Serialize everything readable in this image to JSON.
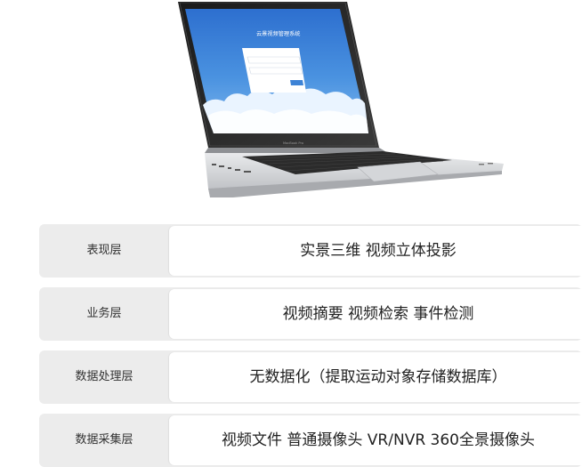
{
  "laptop_screen": {
    "title": "云景视频管理系统",
    "brand": "MacBook Pro",
    "login_button": "登录"
  },
  "architecture": {
    "rows": [
      {
        "layer": "表现层",
        "content": "实景三维  视频立体投影"
      },
      {
        "layer": "业务层",
        "content": "视频摘要  视频检索  事件检测"
      },
      {
        "layer": "数据处理层",
        "content": "无数据化（提取运动对象存储数据库）"
      },
      {
        "layer": "数据采集层",
        "content": "视频文件 普通摄像头 VR/NVR  360全景摄像头"
      }
    ]
  },
  "colors": {
    "screen_blue": "#3d83d6",
    "cloud_white": "#eaf4ff",
    "row_gray": "#ececec",
    "content_white": "#ffffff"
  }
}
